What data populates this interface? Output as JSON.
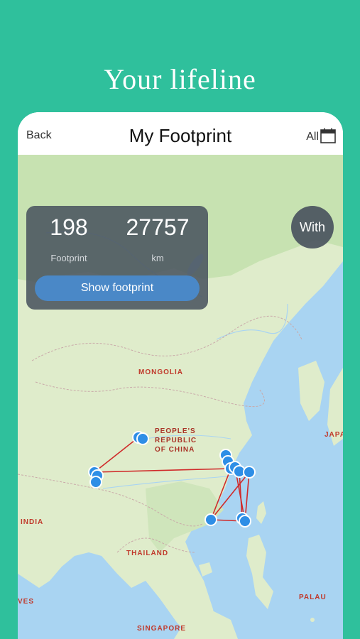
{
  "headline": "Your lifeline",
  "nav": {
    "back_label": "Back",
    "title": "My Footprint",
    "filter_label": "All",
    "calendar_icon": "calendar-icon"
  },
  "stats": {
    "footprint_count": "198",
    "footprint_label": "Footprint",
    "distance": "27757",
    "distance_label": "km",
    "show_button_label": "Show footprint"
  },
  "with_button_label": "With",
  "map": {
    "labels": {
      "mongolia": "MONGOLIA",
      "china_line1": "PEOPLE'S",
      "china_line2": "REPUBLIC",
      "china_line3": "OF CHINA",
      "india": "INDIA",
      "thailand": "THAILAND",
      "japan": "JAPA",
      "palau": "PALAU",
      "singapore": "SINGAPORE",
      "left_edge": "VES"
    },
    "colors": {
      "water": "#a9d4f2",
      "land": "#dfeccb",
      "forest": "#c7e2b1",
      "route": "#d02a2a",
      "marker": "#2e8ee6"
    }
  }
}
